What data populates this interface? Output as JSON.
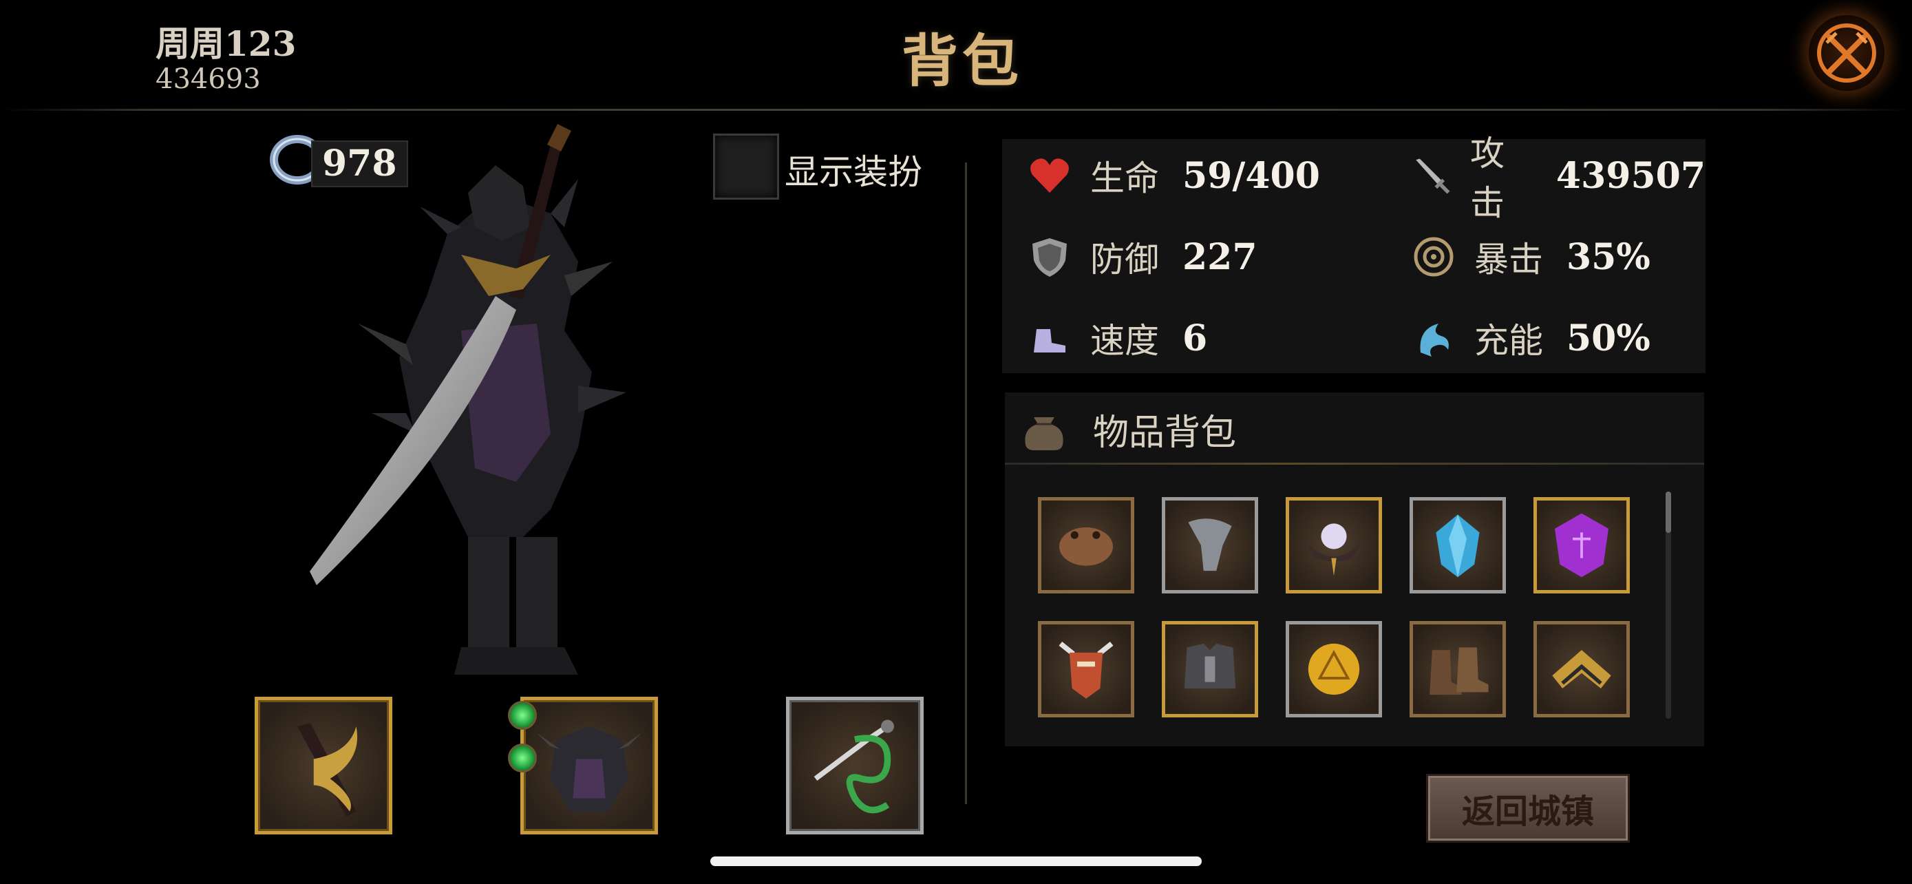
{
  "header": {
    "player_name": "周周123",
    "player_id": "434693",
    "title": "背包",
    "close_icon": "crossed-swords-close-icon"
  },
  "character": {
    "currency_icon": "ring-icon",
    "currency_value": "978",
    "costume_toggle_label": "显示装扮",
    "equipment_slots": [
      {
        "name": "weapon-slot",
        "icon": "curved-blade-icon",
        "frame": "gold"
      },
      {
        "name": "armor-slot",
        "icon": "dark-armor-icon",
        "frame": "gold",
        "gem_sockets": 2
      },
      {
        "name": "accessory-slot",
        "icon": "green-amulet-icon",
        "frame": "silver"
      }
    ]
  },
  "stats": [
    {
      "icon": "heart-icon",
      "label": "生命",
      "value": "59/400"
    },
    {
      "icon": "sword-icon",
      "label": "攻击",
      "value": "439507"
    },
    {
      "icon": "shield-icon",
      "label": "防御",
      "value": "227"
    },
    {
      "icon": "crit-target-icon",
      "label": "暴击",
      "value": "35%"
    },
    {
      "icon": "boot-speed-icon",
      "label": "速度",
      "value": "6"
    },
    {
      "icon": "energy-swirl-icon",
      "label": "充能",
      "value": "50%"
    }
  ],
  "inventory": {
    "title": "物品背包",
    "header_icon": "bag-icon",
    "items": [
      {
        "name": "toad-item",
        "frame": "bronze"
      },
      {
        "name": "gauntlet-item",
        "frame": "silver"
      },
      {
        "name": "orb-crown-item",
        "frame": "gold"
      },
      {
        "name": "blue-crystal-item",
        "frame": "silver"
      },
      {
        "name": "purple-gem-item",
        "frame": "gold"
      },
      {
        "name": "totem-mask-item",
        "frame": "bronze"
      },
      {
        "name": "chest-armor-item",
        "frame": "gold"
      },
      {
        "name": "gold-coin-item",
        "frame": "silver"
      },
      {
        "name": "boots-item",
        "frame": "bronze"
      },
      {
        "name": "gold-helm-item",
        "frame": "bronze"
      }
    ]
  },
  "footer": {
    "return_label": "返回城镇"
  },
  "colors": {
    "title_gold": "#d8b57a",
    "frame_gold": "#c79a3a",
    "frame_silver": "#a9a9a9",
    "panel_bg": "#131313"
  }
}
